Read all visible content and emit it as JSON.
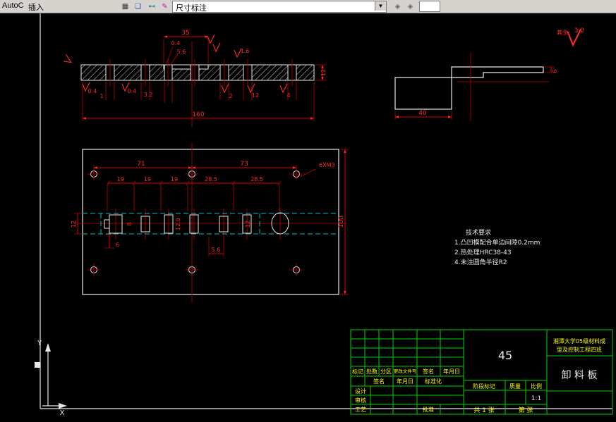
{
  "toolbar": {
    "window_text": "AutoC",
    "menu_insert": "插入",
    "dimstyle_value": "尺寸标注",
    "combo_arrow": "▼",
    "icons": [
      {
        "name": "block-icon",
        "glyph": "▦"
      },
      {
        "name": "hatch-icon",
        "glyph": "❏"
      },
      {
        "name": "dim-linear-icon",
        "glyph": "⊷"
      },
      {
        "name": "dim-style-icon",
        "glyph": "✎"
      },
      {
        "name": "view-3d-icon",
        "glyph": "◈"
      },
      {
        "name": "orbit-icon",
        "glyph": "◈"
      }
    ]
  },
  "canvas": {
    "section_view": {
      "dim_35": "35",
      "dim_04_top": "0.4",
      "dim_56_top": "5.6",
      "dim_16": "1.6",
      "dim_12_right": "12",
      "dim_160": "160",
      "dim_04_a": "0.4",
      "dim_1": "1",
      "dim_04_b": "0.4",
      "dim_32": "3.2",
      "dim_2": "2",
      "dim_12_b": "12",
      "dim_4": "4"
    },
    "side_view": {
      "dim_40": "40",
      "dim_6": "6"
    },
    "plan_view": {
      "dim_71": "71",
      "dim_73": "73",
      "dim_19_a": "19",
      "dim_19_b": "19",
      "dim_19_c": "19",
      "dim_285_a": "28.5",
      "dim_285_b": "28.5",
      "dim_100": "100",
      "thread_note": "6XM3",
      "dim_8": "8",
      "dim_129": "12.9",
      "dim_12": "12",
      "dim_12_left": "12",
      "dim_56": "5.6",
      "dim_6": "6"
    },
    "roughness": {
      "prefix": "其余",
      "value": "3.2"
    },
    "tech": {
      "title": "技术要求",
      "line1": "1.凸凹模配合单边间隙0.2mm",
      "line2": "2.热处理HRC38-43",
      "line3": "4.未注圆角半径R2"
    },
    "ucs": {
      "x": "X",
      "y": "Y"
    }
  },
  "titleblock": {
    "material": "45",
    "school_1": "湘潭大学05级材料成",
    "school_2": "型及控制工程四班",
    "part": "卸 料 板",
    "h_mark": "标记",
    "h_count": "处数",
    "h_zone": "分区",
    "h_file": "更改文件号",
    "h_sign": "签名",
    "h_date": "年月日",
    "r2_sign": "签名",
    "r2_date": "年月日",
    "r2_std": "标准化",
    "design": "设计",
    "audit": "审核",
    "craft": "工艺",
    "approve": "批准",
    "stage": "阶段标记",
    "mass": "质量",
    "ratio": "比例",
    "ratio_value": "1:1",
    "total": "共 1 张",
    "no": "第  张"
  }
}
